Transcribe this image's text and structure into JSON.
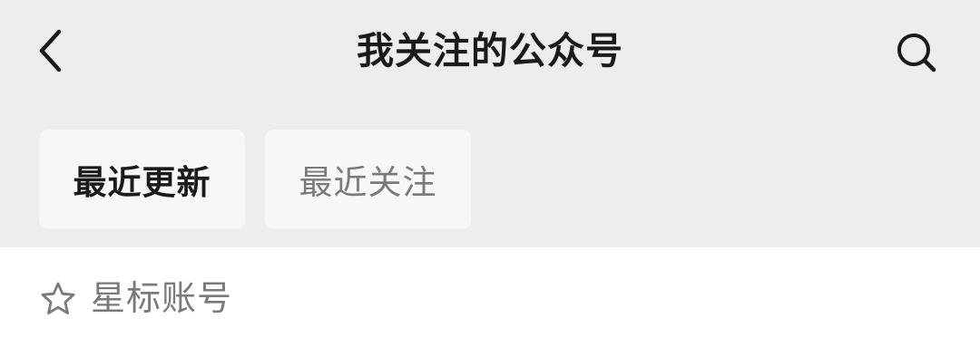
{
  "nav": {
    "title": "我关注的公众号",
    "back_icon": "chevron-left-icon",
    "search_icon": "search-icon"
  },
  "tabs": [
    {
      "label": "最近更新",
      "active": true
    },
    {
      "label": "最近关注",
      "active": false
    }
  ],
  "starred": {
    "icon": "star-outline-icon",
    "label": "星标账号"
  },
  "colors": {
    "header_bg": "#ededed",
    "tab_bg": "#f7f7f7",
    "content_bg": "#ffffff",
    "active_text": "#1a1a1a",
    "inactive_text": "#7a7a7a"
  }
}
